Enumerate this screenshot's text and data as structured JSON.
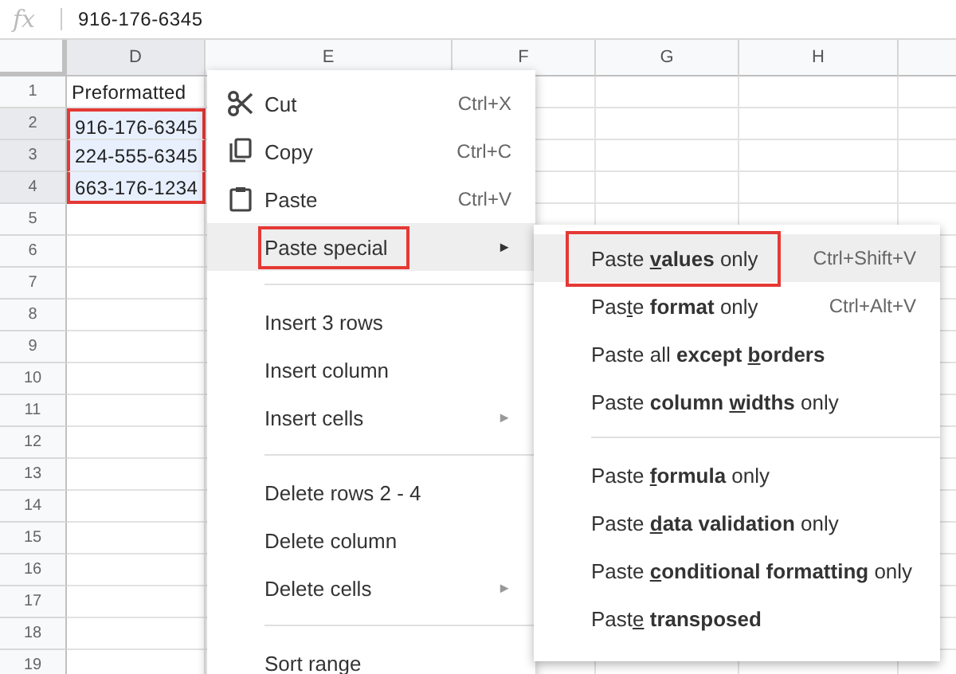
{
  "formula_bar": {
    "fx_label": "fx",
    "value": "916-176-6345"
  },
  "sheet": {
    "columns": [
      {
        "label": "D",
        "selected": true
      },
      {
        "label": "E",
        "selected": false
      },
      {
        "label": "F",
        "selected": false
      },
      {
        "label": "G",
        "selected": false
      },
      {
        "label": "H",
        "selected": false
      },
      {
        "selected": false
      }
    ],
    "selection_annotated": true,
    "rows": [
      {
        "number": "1",
        "cell": "Preformatted",
        "selected": false
      },
      {
        "number": "2",
        "cell": "916-176-6345",
        "selected": true
      },
      {
        "number": "3",
        "cell": "224-555-6345",
        "selected": true
      },
      {
        "number": "4",
        "cell": "663-176-1234",
        "selected": true
      },
      {
        "number": "5",
        "selected": false
      },
      {
        "number": "6",
        "selected": false
      },
      {
        "number": "7",
        "selected": false
      },
      {
        "number": "8",
        "selected": false
      },
      {
        "number": "9",
        "selected": false
      },
      {
        "number": "10",
        "selected": false
      },
      {
        "number": "11",
        "selected": false
      },
      {
        "number": "12",
        "selected": false
      },
      {
        "number": "13",
        "selected": false
      },
      {
        "number": "14",
        "selected": false
      },
      {
        "number": "15",
        "selected": false
      },
      {
        "number": "16",
        "selected": false
      },
      {
        "number": "17",
        "selected": false
      },
      {
        "number": "18",
        "selected": false
      },
      {
        "number": "19",
        "selected": false
      }
    ]
  },
  "context_menu": [
    {
      "kind": "item",
      "icon": true,
      "label": "Cut",
      "shortcut": "Ctrl+X",
      "selected": false,
      "annotated": false
    },
    {
      "kind": "item",
      "icon": true,
      "label": "Copy",
      "shortcut": "Ctrl+C",
      "selected": false,
      "annotated": false
    },
    {
      "kind": "item",
      "icon": true,
      "label": "Paste",
      "shortcut": "Ctrl+V",
      "selected": false,
      "annotated": false
    },
    {
      "kind": "item",
      "icon": false,
      "label": "Paste special",
      "arrow": "►",
      "selected": true,
      "annotated": true
    },
    {
      "kind": "separator"
    },
    {
      "kind": "item",
      "icon": false,
      "label": "Insert 3 rows",
      "selected": false,
      "annotated": false
    },
    {
      "kind": "item",
      "icon": false,
      "label": "Insert column",
      "selected": false,
      "annotated": false
    },
    {
      "kind": "item",
      "icon": false,
      "label": "Insert cells",
      "arrow": "►",
      "selected": false,
      "annotated": false
    },
    {
      "kind": "separator"
    },
    {
      "kind": "item",
      "icon": false,
      "label": "Delete rows 2 - 4",
      "selected": false,
      "annotated": false
    },
    {
      "kind": "item",
      "icon": false,
      "label": "Delete column",
      "selected": false,
      "annotated": false
    },
    {
      "kind": "item",
      "icon": false,
      "label": "Delete cells",
      "arrow": "►",
      "selected": false,
      "annotated": false
    },
    {
      "kind": "separator"
    },
    {
      "kind": "item",
      "icon": false,
      "label": "Sort range",
      "selected": false,
      "annotated": false
    }
  ],
  "paste_special_menu": [
    {
      "kind": "item",
      "parts": [
        {
          "text": "Paste ",
          "bold": false,
          "underline": false
        },
        {
          "text": "v",
          "bold": true,
          "underline": true
        },
        {
          "text": "alues",
          "bold": true,
          "underline": false
        },
        {
          "text": " only",
          "bold": false,
          "underline": false
        }
      ],
      "shortcut": "Ctrl+Shift+V",
      "selected": true,
      "annotated": true
    },
    {
      "kind": "item",
      "parts": [
        {
          "text": "Pas",
          "bold": false,
          "underline": false
        },
        {
          "text": "t",
          "bold": false,
          "underline": true
        },
        {
          "text": "e ",
          "bold": false,
          "underline": false
        },
        {
          "text": "format",
          "bold": true,
          "underline": false
        },
        {
          "text": " only",
          "bold": false,
          "underline": false
        }
      ],
      "shortcut": "Ctrl+Alt+V",
      "selected": false,
      "annotated": false
    },
    {
      "kind": "item",
      "parts": [
        {
          "text": "Paste all ",
          "bold": false,
          "underline": false
        },
        {
          "text": "except ",
          "bold": true,
          "underline": false
        },
        {
          "text": "b",
          "bold": true,
          "underline": true
        },
        {
          "text": "orders",
          "bold": true,
          "underline": false
        }
      ],
      "selected": false,
      "annotated": false
    },
    {
      "kind": "item",
      "parts": [
        {
          "text": "Paste ",
          "bold": false,
          "underline": false
        },
        {
          "text": "column ",
          "bold": true,
          "underline": false
        },
        {
          "text": "w",
          "bold": true,
          "underline": true
        },
        {
          "text": "idths",
          "bold": true,
          "underline": false
        },
        {
          "text": " only",
          "bold": false,
          "underline": false
        }
      ],
      "selected": false,
      "annotated": false
    },
    {
      "kind": "separator"
    },
    {
      "kind": "item",
      "parts": [
        {
          "text": "Paste ",
          "bold": false,
          "underline": false
        },
        {
          "text": "f",
          "bold": true,
          "underline": true
        },
        {
          "text": "ormula",
          "bold": true,
          "underline": false
        },
        {
          "text": " only",
          "bold": false,
          "underline": false
        }
      ],
      "selected": false,
      "annotated": false
    },
    {
      "kind": "item",
      "parts": [
        {
          "text": "Paste ",
          "bold": false,
          "underline": false
        },
        {
          "text": "d",
          "bold": true,
          "underline": true
        },
        {
          "text": "ata validation",
          "bold": true,
          "underline": false
        },
        {
          "text": " only",
          "bold": false,
          "underline": false
        }
      ],
      "selected": false,
      "annotated": false
    },
    {
      "kind": "item",
      "parts": [
        {
          "text": "Paste ",
          "bold": false,
          "underline": false
        },
        {
          "text": "c",
          "bold": true,
          "underline": true
        },
        {
          "text": "onditional formatting",
          "bold": true,
          "underline": false
        },
        {
          "text": " only",
          "bold": false,
          "underline": false
        }
      ],
      "selected": false,
      "annotated": false
    },
    {
      "kind": "item",
      "parts": [
        {
          "text": "Past",
          "bold": false,
          "underline": false
        },
        {
          "text": "e",
          "bold": false,
          "underline": true
        },
        {
          "text": " transposed",
          "bold": true,
          "underline": false
        }
      ],
      "selected": false,
      "annotated": false
    }
  ]
}
